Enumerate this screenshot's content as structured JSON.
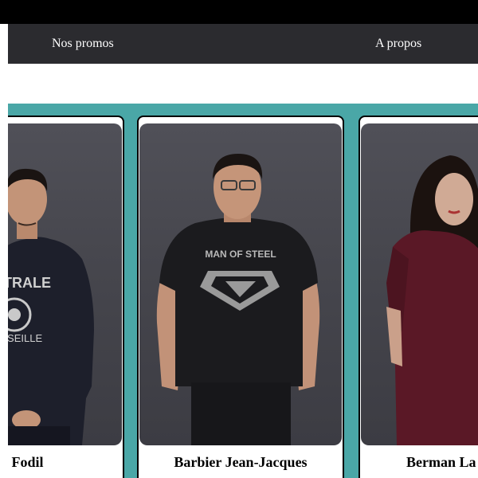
{
  "nav": {
    "items": [
      "Nos promos",
      "A propos"
    ]
  },
  "members": [
    {
      "name": "li Fodil",
      "shirt_text": [
        "NTRALE",
        "ARSEILLE"
      ],
      "shirt_color": "#1d1f2b"
    },
    {
      "name": "Barbier Jean-Jacques",
      "shirt_text": [
        "MAN OF STEEL"
      ],
      "shirt_color": "#1b1b1e"
    },
    {
      "name": "Berman La",
      "shirt_text": [],
      "shirt_color": "#5a1826"
    }
  ],
  "colors": {
    "topbar": "#000000",
    "nav_bg": "#2b2b2f",
    "strip": "#4aa7a7",
    "wall": "#4a4a52"
  }
}
